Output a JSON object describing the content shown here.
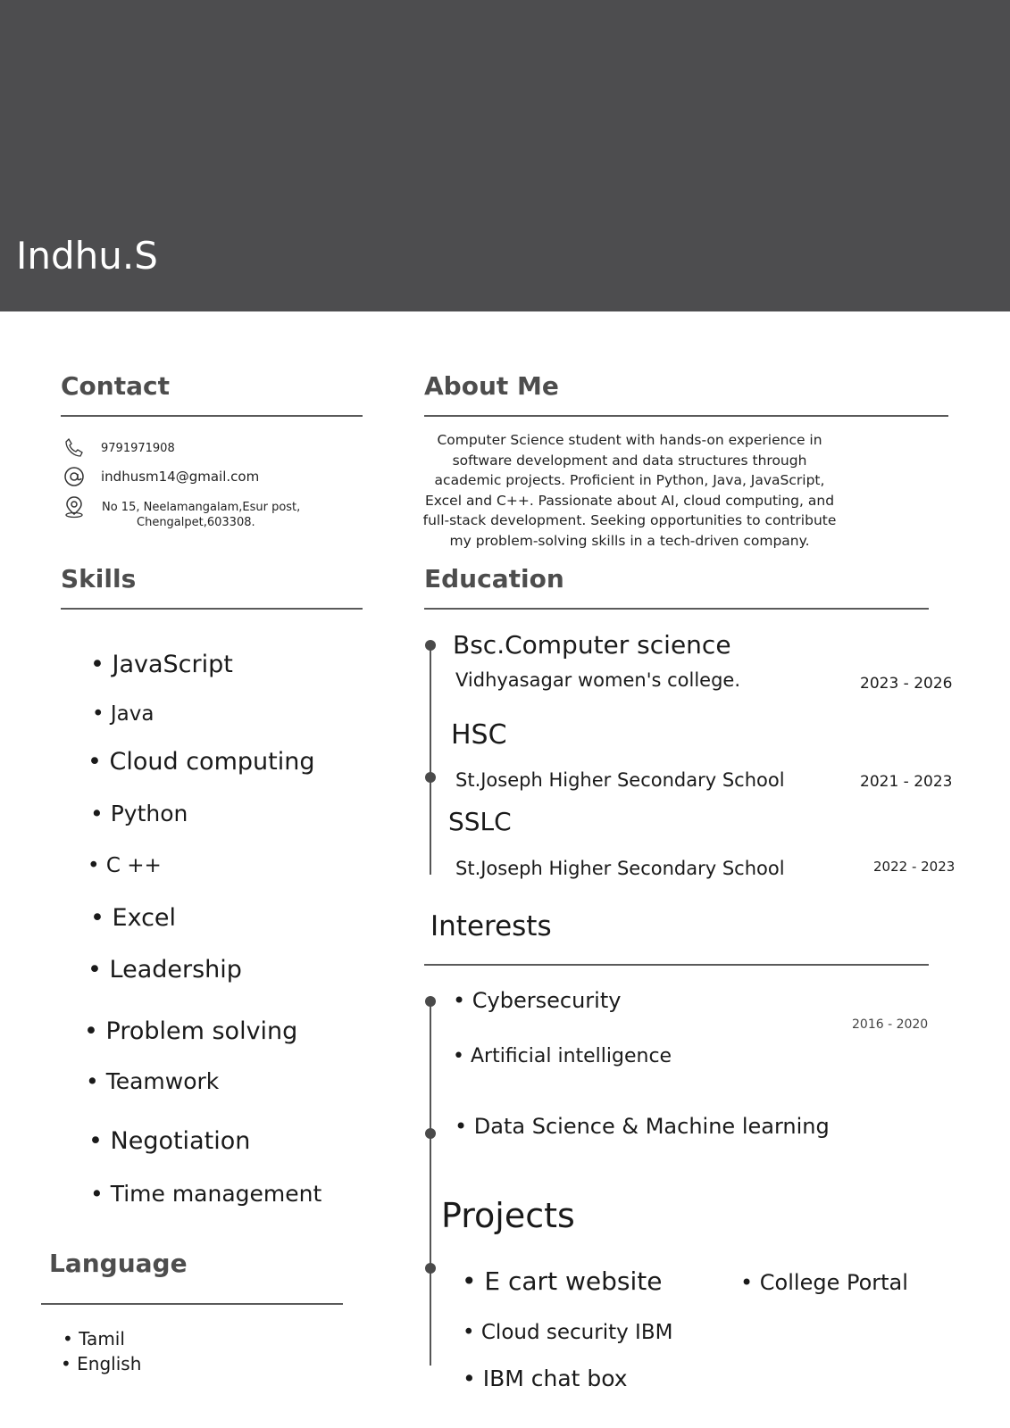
{
  "header": {
    "name": "Indhu.S",
    "background": "#4d4d4f"
  },
  "contact": {
    "heading": "Contact",
    "phone": "9791971908",
    "email": "indhusm14@gmail.com",
    "address_line1": "No 15, Neelamangalam,Esur post,",
    "address_line2": "Chengalpet,603308.",
    "icons": [
      "phone-icon",
      "at-sign-icon",
      "location-pin-icon"
    ]
  },
  "about": {
    "heading": "About Me",
    "lines": [
      "Computer Science student with hands-on experience in",
      "software development and data structures through",
      "academic projects. Proficient in Python, Java, JavaScript,",
      "Excel and C++. Passionate about AI, cloud computing, and",
      "full-stack development. Seeking opportunities to contribute",
      "my problem-solving skills in a tech-driven company."
    ]
  },
  "skills": {
    "heading": "Skills",
    "items": [
      "• JavaScript",
      "• Java",
      "• Cloud computing",
      "•  Python",
      "•  C ++",
      "• Excel",
      "• Leadership",
      "• Problem solving",
      "• Teamwork",
      "• Negotiation",
      "• Time management"
    ]
  },
  "education": {
    "heading": "Education",
    "entries": [
      {
        "degree": "Bsc.Computer science",
        "institution": "Vidhyasagar women's college.",
        "years": "2023 - 2026"
      },
      {
        "degree": "HSC",
        "institution": "St.Joseph Higher Secondary School",
        "years": "2021 - 2023"
      },
      {
        "degree": "SSLC",
        "institution": "St.Joseph Higher Secondary School",
        "years": "2022 - 2023"
      }
    ]
  },
  "interests": {
    "heading": "Interests",
    "items": [
      "• Cybersecurity",
      "• Artificial intelligence",
      "• Data Science & Machine learning"
    ],
    "stray_years": "2016 - 2020"
  },
  "projects": {
    "heading": "Projects",
    "items": [
      "• E cart website",
      "• College Portal",
      "• Cloud security IBM",
      "• IBM chat box"
    ]
  },
  "language": {
    "heading": "Language",
    "items": [
      "• Tamil",
      "• English"
    ]
  }
}
